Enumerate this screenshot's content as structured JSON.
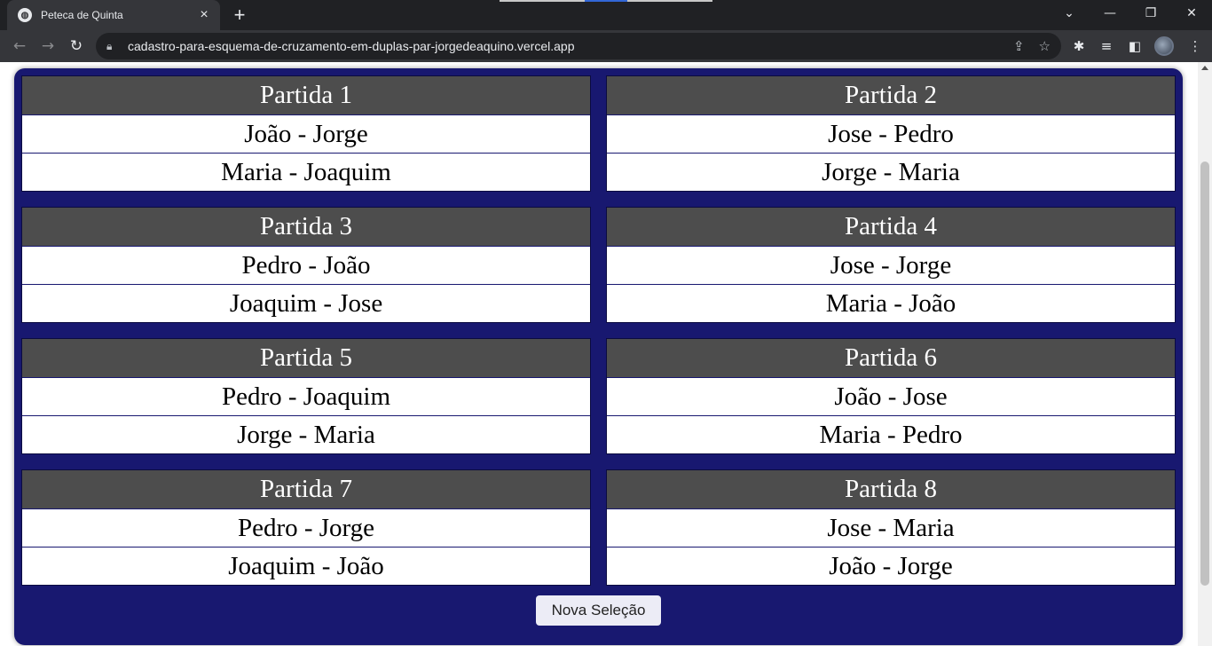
{
  "browser": {
    "tab_title": "Peteca de Quinta",
    "url": "cadastro-para-esquema-de-cruzamento-em-duplas-par-jorgedeaquino.vercel.app",
    "window_controls": [
      "chevron-down",
      "minimize",
      "restore",
      "close"
    ]
  },
  "page": {
    "panel_color": "#181870",
    "header_color": "#4d4d4d",
    "matches": [
      {
        "title": "Partida 1",
        "pairs": [
          "João - Jorge",
          "Maria - Joaquim"
        ]
      },
      {
        "title": "Partida 2",
        "pairs": [
          "Jose - Pedro",
          "Jorge - Maria"
        ]
      },
      {
        "title": "Partida 3",
        "pairs": [
          "Pedro - João",
          "Joaquim - Jose"
        ]
      },
      {
        "title": "Partida 4",
        "pairs": [
          "Jose - Jorge",
          "Maria - João"
        ]
      },
      {
        "title": "Partida 5",
        "pairs": [
          "Pedro - Joaquim",
          "Jorge - Maria"
        ]
      },
      {
        "title": "Partida 6",
        "pairs": [
          "João - Jose",
          "Maria - Pedro"
        ]
      },
      {
        "title": "Partida 7",
        "pairs": [
          "Pedro - Jorge",
          "Joaquim - João"
        ]
      },
      {
        "title": "Partida 8",
        "pairs": [
          "Jose - Maria",
          "João - Jorge"
        ]
      }
    ],
    "new_selection_label": "Nova Seleção"
  }
}
